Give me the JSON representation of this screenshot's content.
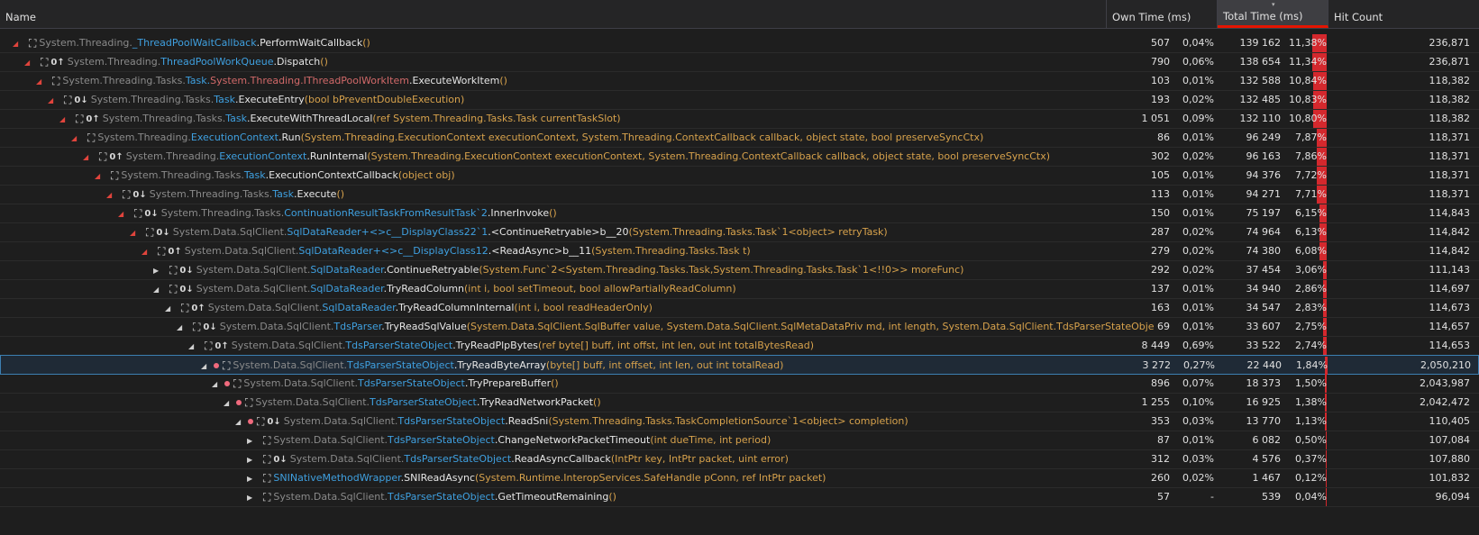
{
  "header": {
    "name": "Name",
    "own_time": "Own Time (ms)",
    "total_time": "Total Time (ms)",
    "hit_count": "Hit Count"
  },
  "rows": [
    {
      "depth": 0,
      "exp": "open",
      "dot": false,
      "icon": "lock-user-icon",
      "ns": "System.Threading.",
      "cls": "_ThreadPoolWaitCallback",
      "iface": "",
      "meth": ".PerformWaitCallback",
      "args": "()",
      "own": "507",
      "own_pct": "0,04%",
      "total": "139 162",
      "total_pct": "11,38%",
      "bar": 0.1138,
      "hits": "236,871"
    },
    {
      "depth": 1,
      "exp": "open",
      "dot": false,
      "icon": "lock-user-icon",
      "icon2": "0f",
      "ns": "System.Threading.",
      "cls": "ThreadPoolWorkQueue",
      "iface": "",
      "meth": ".Dispatch",
      "args": "()",
      "own": "790",
      "own_pct": "0,06%",
      "total": "138 654",
      "total_pct": "11,34%",
      "bar": 0.1134,
      "hits": "236,871"
    },
    {
      "depth": 2,
      "exp": "open",
      "dot": false,
      "icon": "lock-user-icon",
      "ns": "System.Threading.Tasks.",
      "cls": "Task.",
      "iface": "System.Threading.IThreadPoolWorkItem",
      "meth": ".ExecuteWorkItem",
      "args": "()",
      "own": "103",
      "own_pct": "0,01%",
      "total": "132 588",
      "total_pct": "10,84%",
      "bar": 0.1084,
      "hits": "118,382"
    },
    {
      "depth": 3,
      "exp": "open",
      "dot": false,
      "icon": "lock-user-icon",
      "icon2": "0l",
      "ns": "System.Threading.Tasks.",
      "cls": "Task",
      "iface": "",
      "meth": ".ExecuteEntry",
      "args": "(bool bPreventDoubleExecution)",
      "own": "193",
      "own_pct": "0,02%",
      "total": "132 485",
      "total_pct": "10,83%",
      "bar": 0.1083,
      "hits": "118,382"
    },
    {
      "depth": 4,
      "exp": "open",
      "dot": false,
      "icon": "lock-user-icon",
      "icon2": "0f",
      "ns": "System.Threading.Tasks.",
      "cls": "Task",
      "iface": "",
      "meth": ".ExecuteWithThreadLocal",
      "args": "(ref System.Threading.Tasks.Task currentTaskSlot)",
      "own": "1 051",
      "own_pct": "0,09%",
      "total": "132 110",
      "total_pct": "10,80%",
      "bar": 0.108,
      "hits": "118,382"
    },
    {
      "depth": 5,
      "exp": "open",
      "dot": false,
      "icon": "lock-user-icon",
      "ns": "System.Threading.",
      "cls": "ExecutionContext",
      "iface": "",
      "meth": ".Run",
      "args": "(System.Threading.ExecutionContext executionContext, System.Threading.ContextCallback callback, object state, bool preserveSyncCtx)",
      "own": "86",
      "own_pct": "0,01%",
      "total": "96 249",
      "total_pct": "7,87%",
      "bar": 0.0787,
      "hits": "118,371"
    },
    {
      "depth": 6,
      "exp": "open",
      "dot": false,
      "icon": "lock-user-icon",
      "icon2": "0f",
      "ns": "System.Threading.",
      "cls": "ExecutionContext",
      "iface": "",
      "meth": ".RunInternal",
      "args": "(System.Threading.ExecutionContext executionContext, System.Threading.ContextCallback callback, object state, bool preserveSyncCtx)",
      "own": "302",
      "own_pct": "0,02%",
      "total": "96 163",
      "total_pct": "7,86%",
      "bar": 0.0786,
      "hits": "118,371"
    },
    {
      "depth": 7,
      "exp": "open",
      "dot": false,
      "icon": "lock-user-icon",
      "ns": "System.Threading.Tasks.",
      "cls": "Task",
      "iface": "",
      "meth": ".ExecutionContextCallback",
      "args": "(object obj)",
      "own": "105",
      "own_pct": "0,01%",
      "total": "94 376",
      "total_pct": "7,72%",
      "bar": 0.0772,
      "hits": "118,371"
    },
    {
      "depth": 8,
      "exp": "open",
      "dot": false,
      "icon": "lock-user-icon",
      "icon2": "0l",
      "ns": "System.Threading.Tasks.",
      "cls": "Task",
      "iface": "",
      "meth": ".Execute",
      "args": "()",
      "own": "113",
      "own_pct": "0,01%",
      "total": "94 271",
      "total_pct": "7,71%",
      "bar": 0.0771,
      "hits": "118,371"
    },
    {
      "depth": 9,
      "exp": "open",
      "dot": false,
      "icon": "lock-user-icon",
      "icon2": "0l",
      "ns": "System.Threading.Tasks.",
      "cls": "ContinuationResultTaskFromResultTask`2",
      "iface": "",
      "meth": ".InnerInvoke",
      "args": "()",
      "own": "150",
      "own_pct": "0,01%",
      "total": "75 197",
      "total_pct": "6,15%",
      "bar": 0.0615,
      "hits": "114,843"
    },
    {
      "depth": 10,
      "exp": "open",
      "dot": false,
      "icon": "lock-user-icon",
      "icon2": "0l",
      "ns": "System.Data.SqlClient.",
      "cls": "SqlDataReader+<>c__DisplayClass22`1",
      "iface": "",
      "meth": ".<ContinueRetryable>b__20",
      "args": "(System.Threading.Tasks.Task`1<object> retryTask)",
      "own": "287",
      "own_pct": "0,02%",
      "total": "74 964",
      "total_pct": "6,13%",
      "bar": 0.0613,
      "hits": "114,842"
    },
    {
      "depth": 11,
      "exp": "open",
      "dot": false,
      "icon": "lock-user-icon",
      "icon2": "0f",
      "ns": "System.Data.SqlClient.",
      "cls": "SqlDataReader+<>c__DisplayClass12",
      "iface": "",
      "meth": ".<ReadAsync>b__11",
      "args": "(System.Threading.Tasks.Task t)",
      "own": "279",
      "own_pct": "0,02%",
      "total": "74 380",
      "total_pct": "6,08%",
      "bar": 0.0608,
      "hits": "114,842"
    },
    {
      "depth": 12,
      "exp": "closed",
      "dot": false,
      "icon": "lock-user-icon",
      "icon2": "0l",
      "ns": "System.Data.SqlClient.",
      "cls": "SqlDataReader",
      "iface": "",
      "meth": ".ContinueRetryable",
      "args": "(System.Func`2<System.Threading.Tasks.Task,System.Threading.Tasks.Task`1<!!0>> moreFunc)",
      "own": "292",
      "own_pct": "0,02%",
      "total": "37 454",
      "total_pct": "3,06%",
      "bar": 0.0306,
      "hits": "111,143"
    },
    {
      "depth": 12,
      "exp": "grey",
      "dot": false,
      "icon": "lock-user-icon",
      "icon2": "0l",
      "ns": "System.Data.SqlClient.",
      "cls": "SqlDataReader",
      "iface": "",
      "meth": ".TryReadColumn",
      "args": "(int i, bool setTimeout, bool allowPartiallyReadColumn)",
      "own": "137",
      "own_pct": "0,01%",
      "total": "34 940",
      "total_pct": "2,86%",
      "bar": 0.0286,
      "hits": "114,697"
    },
    {
      "depth": 13,
      "exp": "grey",
      "dot": false,
      "icon": "lock-user-icon",
      "icon2": "0f",
      "ns": "System.Data.SqlClient.",
      "cls": "SqlDataReader",
      "iface": "",
      "meth": ".TryReadColumnInternal",
      "args": "(int i, bool readHeaderOnly)",
      "own": "163",
      "own_pct": "0,01%",
      "total": "34 547",
      "total_pct": "2,83%",
      "bar": 0.0283,
      "hits": "114,673"
    },
    {
      "depth": 14,
      "exp": "grey",
      "dot": false,
      "icon": "lock-user-icon",
      "icon2": "0l",
      "ns": "System.Data.SqlClient.",
      "cls": "TdsParser",
      "iface": "",
      "meth": ".TryReadSqlValue",
      "args": "(System.Data.SqlClient.SqlBuffer value, System.Data.SqlClient.SqlMetaDataPriv md, int length, System.Data.SqlClient.TdsParserStateObje",
      "own": "69",
      "own_pct": "0,01%",
      "total": "33 607",
      "total_pct": "2,75%",
      "bar": 0.0275,
      "hits": "114,657"
    },
    {
      "depth": 15,
      "exp": "grey",
      "dot": false,
      "icon": "lock-user-icon",
      "icon2": "0f",
      "ns": "System.Data.SqlClient.",
      "cls": "TdsParserStateObject",
      "iface": "",
      "meth": ".TryReadPlpBytes",
      "args": "(ref byte[] buff, int offst, int len, out int totalBytesRead)",
      "own": "8 449",
      "own_pct": "0,69%",
      "total": "33 522",
      "total_pct": "2,74%",
      "bar": 0.0274,
      "hits": "114,653"
    },
    {
      "depth": 16,
      "exp": "grey",
      "dot": true,
      "selected": true,
      "icon": "lock-user-icon",
      "ns": "System.Data.SqlClient.",
      "cls": "TdsParserStateObject",
      "iface": "",
      "meth": ".TryReadByteArray",
      "args": "(byte[] buff, int offset, int len, out int totalRead)",
      "own": "3 272",
      "own_pct": "0,27%",
      "total": "22 440",
      "total_pct": "1,84%",
      "bar": 0.0184,
      "hits": "2,050,210"
    },
    {
      "depth": 17,
      "exp": "grey",
      "dot": true,
      "icon": "lock-user-icon",
      "ns": "System.Data.SqlClient.",
      "cls": "TdsParserStateObject",
      "iface": "",
      "meth": ".TryPrepareBuffer",
      "args": "()",
      "own": "896",
      "own_pct": "0,07%",
      "total": "18 373",
      "total_pct": "1,50%",
      "bar": 0.015,
      "hits": "2,043,987"
    },
    {
      "depth": 18,
      "exp": "grey",
      "dot": true,
      "icon": "lock-user-icon",
      "ns": "System.Data.SqlClient.",
      "cls": "TdsParserStateObject",
      "iface": "",
      "meth": ".TryReadNetworkPacket",
      "args": "()",
      "own": "1 255",
      "own_pct": "0,10%",
      "total": "16 925",
      "total_pct": "1,38%",
      "bar": 0.0138,
      "hits": "2,042,472"
    },
    {
      "depth": 19,
      "exp": "grey",
      "dot": true,
      "icon": "lock-user-icon",
      "icon2": "0l",
      "ns": "System.Data.SqlClient.",
      "cls": "TdsParserStateObject",
      "iface": "",
      "meth": ".ReadSni",
      "args": "(System.Threading.Tasks.TaskCompletionSource`1<object> completion)",
      "own": "353",
      "own_pct": "0,03%",
      "total": "13 770",
      "total_pct": "1,13%",
      "bar": 0.0113,
      "hits": "110,405"
    },
    {
      "depth": 20,
      "exp": "closed",
      "dot": false,
      "icon": "lock-user-icon",
      "ns": "System.Data.SqlClient.",
      "cls": "TdsParserStateObject",
      "iface": "",
      "meth": ".ChangeNetworkPacketTimeout",
      "args": "(int dueTime, int period)",
      "own": "87",
      "own_pct": "0,01%",
      "total": "6 082",
      "total_pct": "0,50%",
      "bar": 0.005,
      "hits": "107,084"
    },
    {
      "depth": 20,
      "exp": "closed",
      "dot": false,
      "icon": "lock-user-icon",
      "icon2": "0l",
      "ns": "System.Data.SqlClient.",
      "cls": "TdsParserStateObject",
      "iface": "",
      "meth": ".ReadAsyncCallback",
      "args": "(IntPtr key, IntPtr packet, uint error)",
      "own": "312",
      "own_pct": "0,03%",
      "total": "4 576",
      "total_pct": "0,37%",
      "bar": 0.0037,
      "hits": "107,880"
    },
    {
      "depth": 20,
      "exp": "closed",
      "dot": false,
      "icon": "lock-user-icon",
      "ns": "",
      "cls": "SNINativeMethodWrapper",
      "iface": "",
      "meth": ".SNIReadAsync",
      "args": "(System.Runtime.InteropServices.SafeHandle pConn, ref IntPtr packet)",
      "own": "260",
      "own_pct": "0,02%",
      "total": "1 467",
      "total_pct": "0,12%",
      "bar": 0.0012,
      "hits": "101,832"
    },
    {
      "depth": 20,
      "exp": "closed",
      "dot": false,
      "icon": "lock-user-icon",
      "ns": "System.Data.SqlClient.",
      "cls": "TdsParserStateObject",
      "iface": "",
      "meth": ".GetTimeoutRemaining",
      "args": "()",
      "own": "57",
      "own_pct": "-",
      "total": "539",
      "total_pct": "0,04%",
      "bar": 0.0004,
      "hits": "96,094"
    }
  ]
}
